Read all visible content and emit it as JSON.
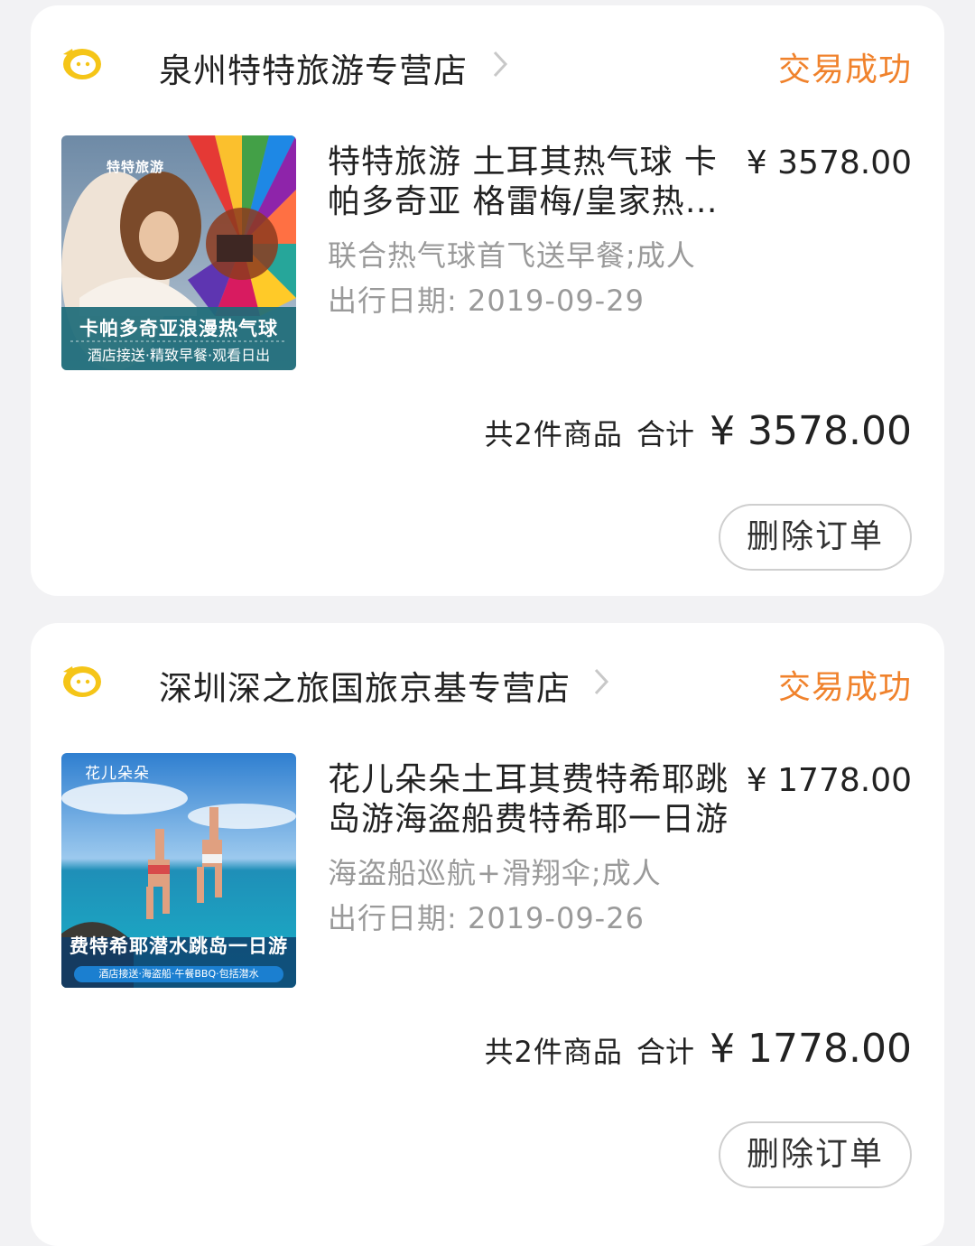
{
  "orders": [
    {
      "shop_name": "泉州特特旅游专营店",
      "status": "交易成功",
      "product": {
        "title": "特特旅游 土耳其热气球 卡帕多奇亚 格雷梅/皇家热气球",
        "price": "¥ 3578.00",
        "sku": "联合热气球首飞送早餐;成人",
        "date_label": "出行日期: ",
        "date_value": "2019-09-29",
        "thumb_brand": "特特旅游",
        "thumb_title": "卡帕多奇亚浪漫热气球",
        "thumb_sub": "酒店接送·精致早餐·观看日出"
      },
      "total": {
        "count_text": "共2件商品",
        "label": "合计",
        "amount": "¥ 3578.00"
      },
      "delete_label": "删除订单"
    },
    {
      "shop_name": "深圳深之旅国旅京基专营店",
      "status": "交易成功",
      "product": {
        "title": "花儿朵朵土耳其费特希耶跳岛游海盗船费特希耶一日游",
        "price": "¥ 1778.00",
        "sku": "海盗船巡航+滑翔伞;成人",
        "date_label": "出行日期: ",
        "date_value": "2019-09-26",
        "thumb_brand": "花儿朵朵",
        "thumb_title": "费特希耶潜水跳岛一日游",
        "thumb_sub": "酒店接送·海盗船·午餐BBQ·包括潜水"
      },
      "total": {
        "count_text": "共2件商品",
        "label": "合计",
        "amount": "¥ 1778.00"
      },
      "delete_label": "删除订单"
    }
  ],
  "colors": {
    "status": "#f0822c",
    "muted": "#9a9a9a",
    "page_bg": "#f2f2f4",
    "icon_yellow": "#f5c518"
  },
  "icons": {
    "shop": "fliggy-shop-icon",
    "chevron": "chevron-right-icon"
  }
}
